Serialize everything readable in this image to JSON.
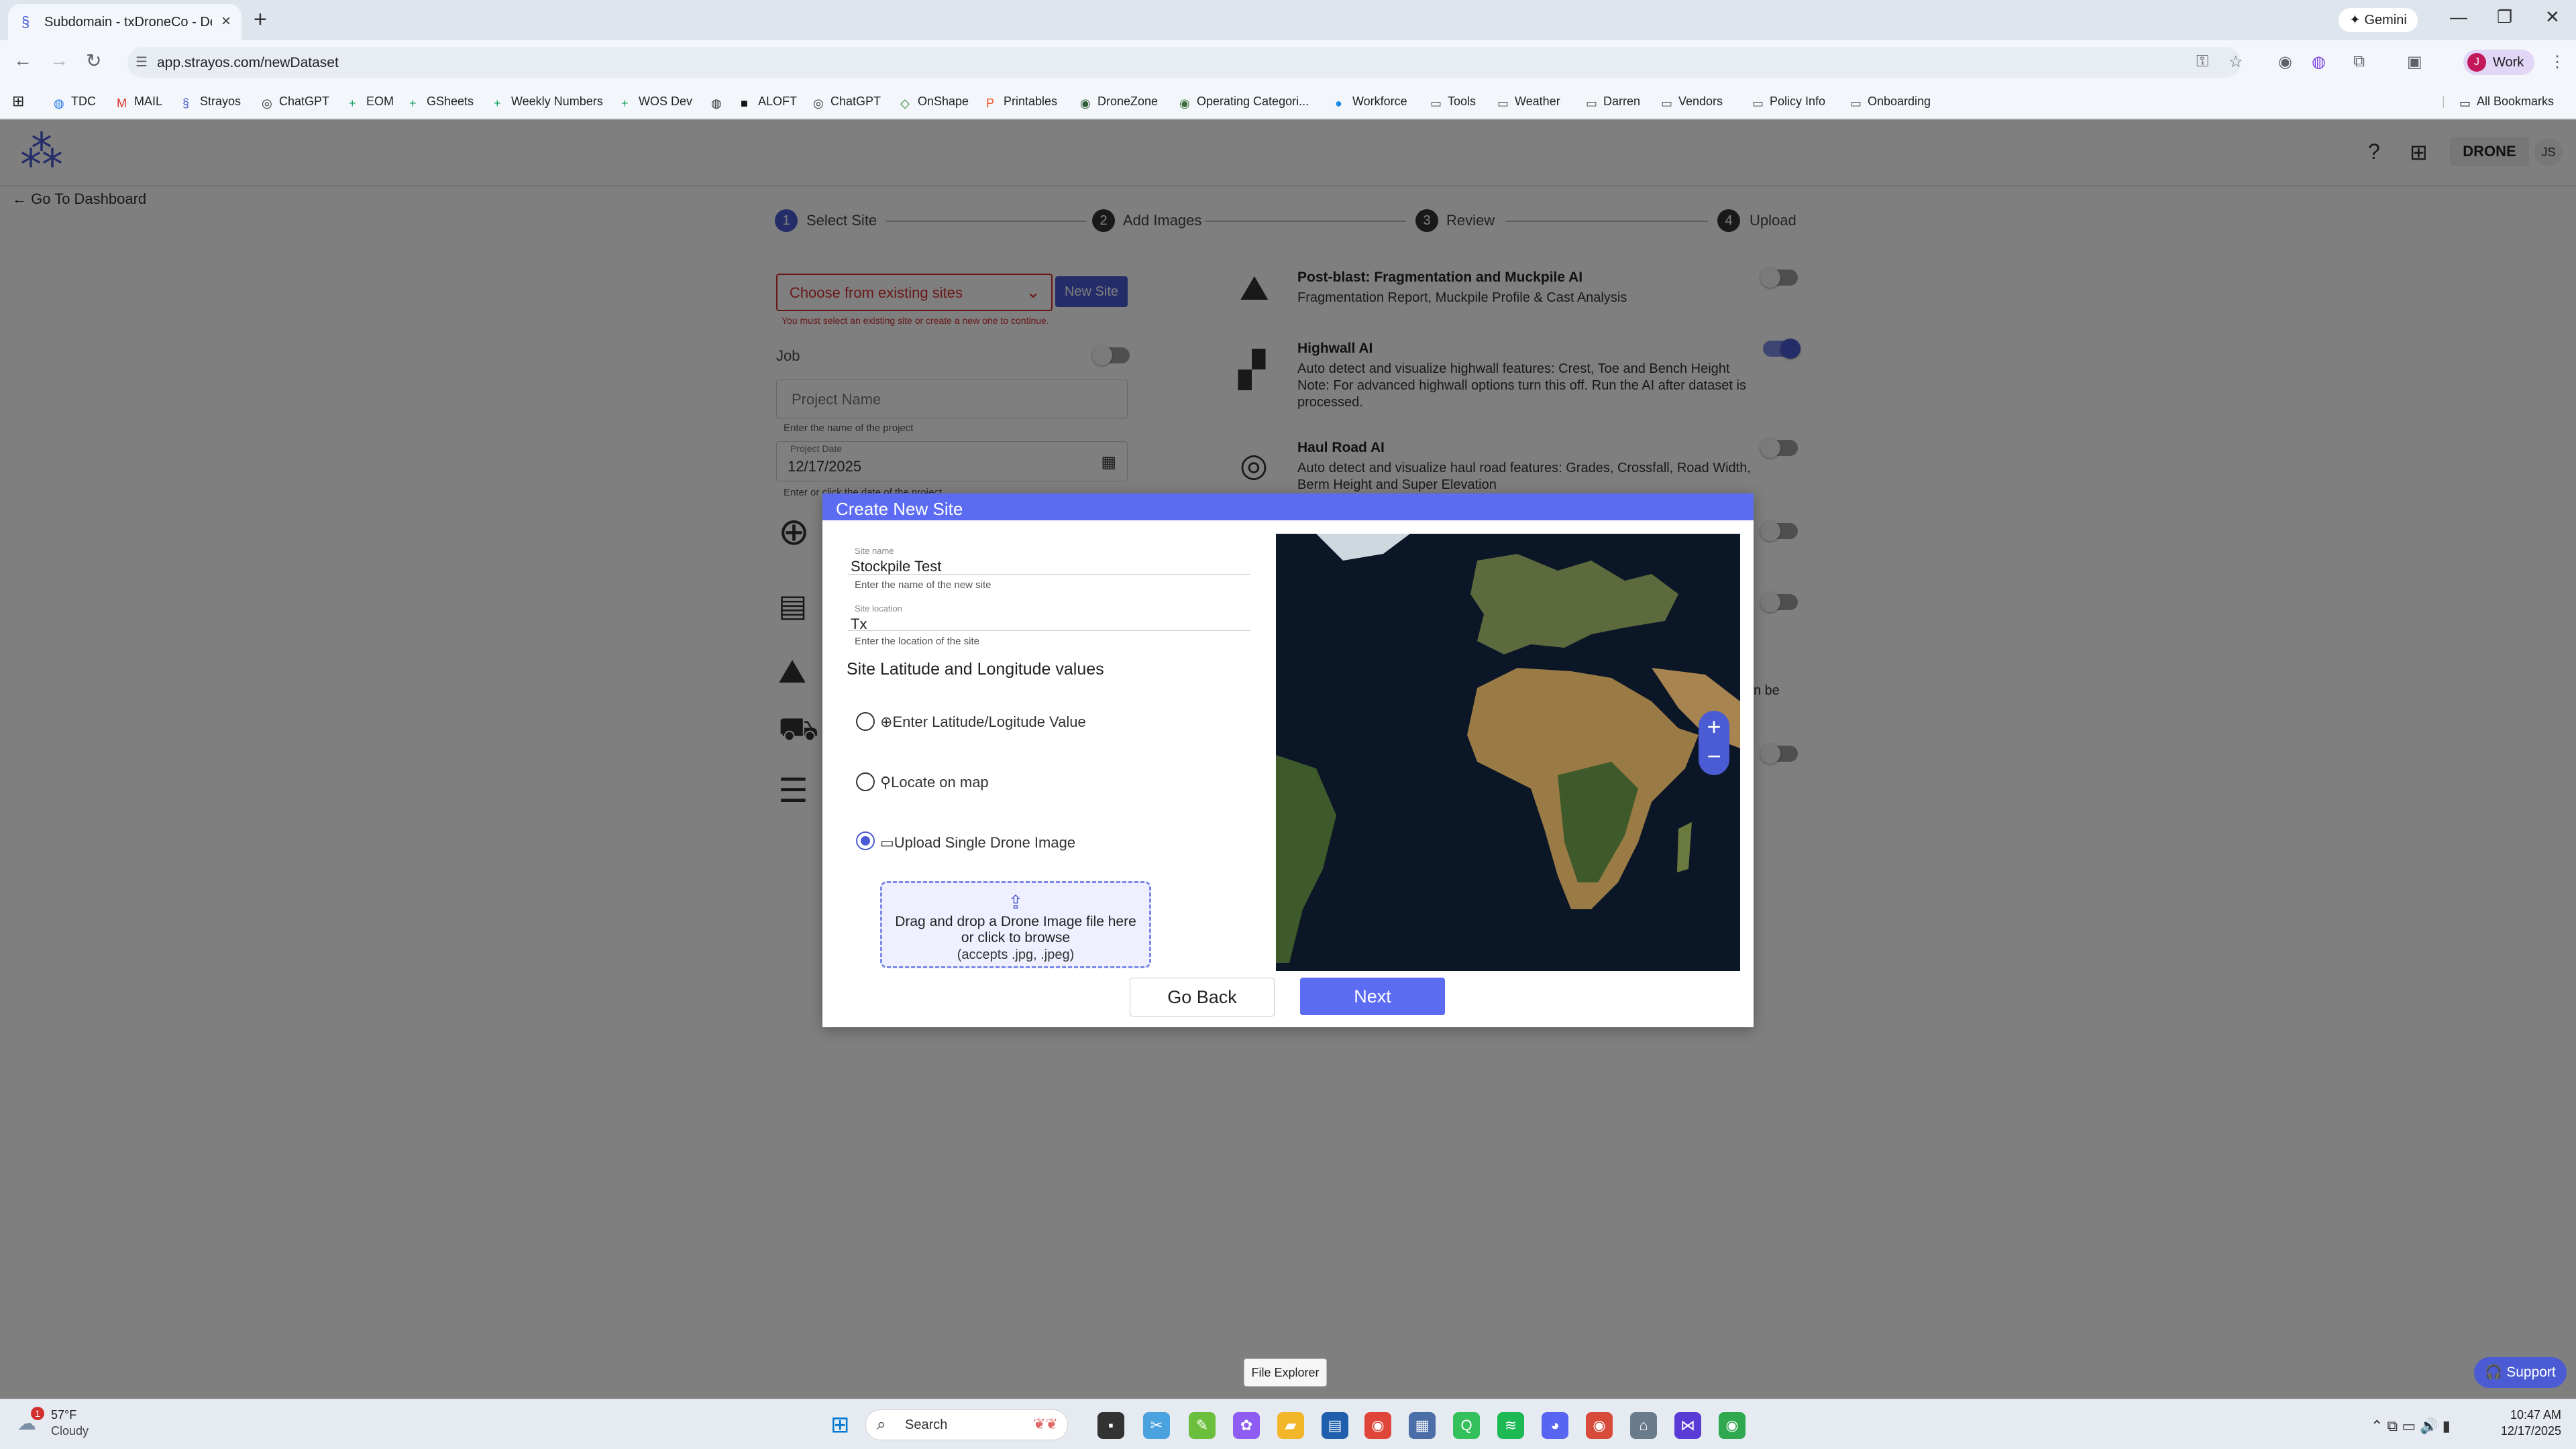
{
  "browser": {
    "tab_title": "Subdomain - txDroneCo - Dem",
    "url": "app.strayos.com/newDataset",
    "gemini_label": "Gemini",
    "profile_initial": "J",
    "profile_label": "Work",
    "bookmarks": [
      {
        "label": "TDC",
        "icon": "globe-icon",
        "color": "#1a73e8"
      },
      {
        "label": "MAIL",
        "icon": "gmail-icon",
        "color": "#d93025"
      },
      {
        "label": "Strayos",
        "icon": "strayos-icon",
        "color": "#4a5bd3"
      },
      {
        "label": "ChatGPT",
        "icon": "chatgpt-icon",
        "color": "#333333"
      },
      {
        "label": "EOM",
        "icon": "sheets-icon",
        "color": "#0f9d58"
      },
      {
        "label": "GSheets",
        "icon": "sheets-icon",
        "color": "#0f9d58"
      },
      {
        "label": "Weekly Numbers",
        "icon": "sheets-icon",
        "color": "#0f9d58"
      },
      {
        "label": "WOS Dev",
        "icon": "sheets-icon",
        "color": "#0f9d58"
      },
      {
        "label": "",
        "icon": "globe-icon",
        "color": "#333333"
      },
      {
        "label": "ALOFT",
        "icon": "aloft-icon",
        "color": "#111111"
      },
      {
        "label": "ChatGPT",
        "icon": "chatgpt-icon",
        "color": "#333333"
      },
      {
        "label": "OnShape",
        "icon": "onshape-icon",
        "color": "#2e7d32"
      },
      {
        "label": "Printables",
        "icon": "printables-icon",
        "color": "#f4511e"
      },
      {
        "label": "DroneZone",
        "icon": "dronezone-icon",
        "color": "#2e5d3a"
      },
      {
        "label": "Operating Categori...",
        "icon": "faa-icon",
        "color": "#3b6e3b"
      },
      {
        "label": "Workforce",
        "icon": "workforce-icon",
        "color": "#1e88e5"
      },
      {
        "label": "Tools",
        "icon": "folder-icon",
        "color": "#555555"
      },
      {
        "label": "Weather",
        "icon": "folder-icon",
        "color": "#555555"
      },
      {
        "label": "Darren",
        "icon": "folder-icon",
        "color": "#555555"
      },
      {
        "label": "Vendors",
        "icon": "folder-icon",
        "color": "#555555"
      },
      {
        "label": "Policy Info",
        "icon": "folder-icon",
        "color": "#555555"
      },
      {
        "label": "Onboarding",
        "icon": "folder-icon",
        "color": "#555555"
      }
    ],
    "all_bookmarks": "All Bookmarks"
  },
  "app": {
    "brand": "DRONE",
    "user_initials": "JS",
    "back_link": "Go To Dashboard",
    "steps": [
      {
        "num": "1",
        "label": "Select Site"
      },
      {
        "num": "2",
        "label": "Add Images"
      },
      {
        "num": "3",
        "label": "Review"
      },
      {
        "num": "4",
        "label": "Upload"
      }
    ],
    "site_select_placeholder": "Choose from existing sites",
    "new_site_button": "New Site",
    "site_error": "You must select an existing site or create a new one to continue.",
    "job_label": "Job",
    "project_name_placeholder": "Project Name",
    "project_name_helper": "Enter the name of the project",
    "project_date_label": "Project Date",
    "project_date_value": "12/17/2025",
    "project_date_helper": "Enter or click the date of the project",
    "features": [
      {
        "title": "Post-blast: Fragmentation and Muckpile AI",
        "desc": "Fragmentation Report, Muckpile Profile & Cast Analysis",
        "on": false
      },
      {
        "title": "Highwall AI",
        "desc": "Auto detect and visualize highwall features: Crest, Toe and Bench Height Note: For advanced highwall options turn this off. Run the AI after dataset is processed.",
        "on": true
      },
      {
        "title": "Haul Road AI",
        "desc": "Auto detect and visualize haul road features: Grades, Crossfall, Road Width, Berm Height and Super Elevation",
        "on": false
      }
    ],
    "partial_text": "n be"
  },
  "modal": {
    "title": "Create New Site",
    "site_name_label": "Site name",
    "site_name_value": "Stockpile Test",
    "site_name_helper": "Enter the name of the new site",
    "site_location_label": "Site location",
    "site_location_value": "Tx",
    "site_location_helper": "Enter the location of the site",
    "latlng_heading": "Site Latitude and Longitude values",
    "options": [
      {
        "label": "Enter Latitude/Logitude Value",
        "icon": "globe-icon",
        "selected": false
      },
      {
        "label": "Locate on map",
        "icon": "map-pin-icon",
        "selected": false
      },
      {
        "label": "Upload Single Drone Image",
        "icon": "image-icon",
        "selected": true
      }
    ],
    "drop_text": "Drag and drop a Drone Image file here or click to browse",
    "drop_accepts": "(accepts .jpg, .jpeg)",
    "zoom_in": "+",
    "zoom_out": "−",
    "go_back": "Go Back",
    "next": "Next"
  },
  "tooltip": "File Explorer",
  "support": "Support",
  "taskbar": {
    "temp": "57°F",
    "condition": "Cloudy",
    "weather_badge": "1",
    "search": "Search",
    "time": "10:47 AM",
    "date": "12/17/2025"
  }
}
